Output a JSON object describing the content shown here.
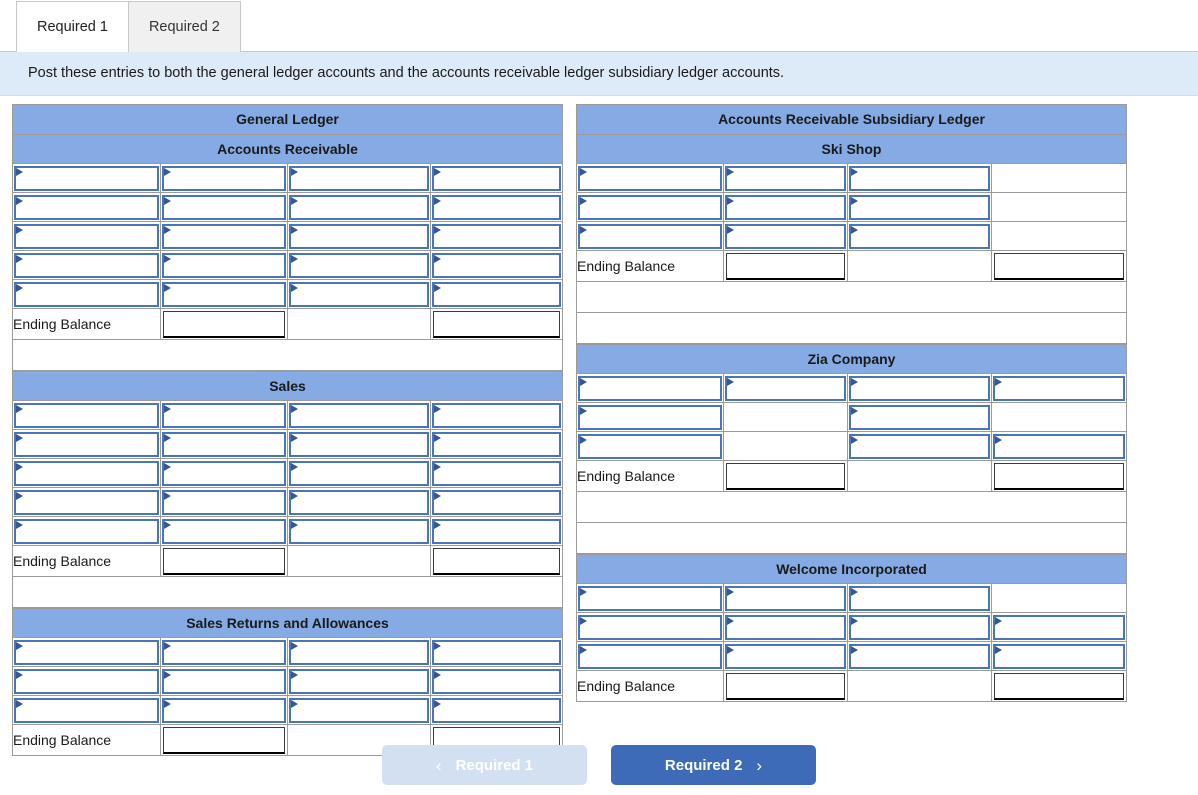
{
  "tabs": [
    {
      "label": "Required 1",
      "active": true
    },
    {
      "label": "Required 2",
      "active": false
    }
  ],
  "banner": {
    "text": "Post these entries to both the general ledger accounts and the accounts receivable ledger subsidiary ledger accounts."
  },
  "colors": {
    "header_blue": "#85aae4",
    "input_border_blue": "#4a75b8",
    "marker_blue": "#35598f",
    "banner_blue": "#ddeaf8",
    "next_button_blue": "#3d6bb7",
    "prev_button_blue": "#d3e0f2"
  },
  "ending_balance_label": "Ending Balance",
  "left_panel": {
    "title": "General Ledger",
    "accounts": [
      {
        "name": "Accounts Receivable",
        "rows": [
          [
            true,
            true,
            true,
            true
          ],
          [
            true,
            true,
            true,
            true
          ],
          [
            true,
            true,
            true,
            true
          ],
          [
            true,
            true,
            true,
            true
          ],
          [
            true,
            true,
            true,
            true
          ]
        ],
        "ending_balance": [
          false,
          true,
          false,
          true
        ],
        "filler_rows": 1
      },
      {
        "name": "Sales",
        "rows": [
          [
            true,
            true,
            true,
            true
          ],
          [
            true,
            true,
            true,
            true
          ],
          [
            true,
            true,
            true,
            true
          ],
          [
            true,
            true,
            true,
            true
          ],
          [
            true,
            true,
            true,
            true
          ]
        ],
        "ending_balance": [
          false,
          true,
          false,
          true
        ],
        "filler_rows": 1
      },
      {
        "name": "Sales Returns and Allowances",
        "rows": [
          [
            true,
            true,
            true,
            true
          ],
          [
            true,
            true,
            true,
            true
          ],
          [
            true,
            true,
            true,
            true
          ]
        ],
        "ending_balance": [
          false,
          true,
          false,
          true
        ],
        "filler_rows": 0
      }
    ]
  },
  "right_panel": {
    "title": "Accounts Receivable Subsidiary Ledger",
    "accounts": [
      {
        "name": "Ski Shop",
        "rows": [
          [
            true,
            true,
            true,
            false
          ],
          [
            true,
            true,
            true,
            false
          ],
          [
            true,
            true,
            true,
            false
          ]
        ],
        "ending_balance": [
          false,
          true,
          false,
          true
        ],
        "filler_rows": 2
      },
      {
        "name": "Zia Company",
        "rows": [
          [
            true,
            true,
            true,
            true
          ],
          [
            true,
            false,
            true,
            false
          ],
          [
            true,
            false,
            true,
            true
          ]
        ],
        "ending_balance": [
          false,
          true,
          false,
          true
        ],
        "filler_rows": 2
      },
      {
        "name": "Welcome Incorporated",
        "rows": [
          [
            true,
            true,
            true,
            false
          ],
          [
            true,
            true,
            true,
            true
          ],
          [
            true,
            true,
            true,
            true
          ]
        ],
        "ending_balance": [
          false,
          true,
          false,
          true
        ],
        "filler_rows": 0
      }
    ]
  },
  "footer": {
    "prev_label": "Required 1",
    "prev_chevron": "‹",
    "next_label": "Required 2",
    "next_chevron": "›"
  }
}
